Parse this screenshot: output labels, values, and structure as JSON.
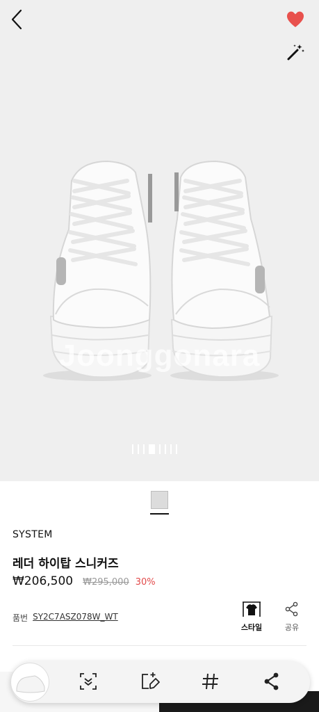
{
  "hero": {
    "watermark": "Joonggonara",
    "pager": {
      "count": 8,
      "active_index": 3
    }
  },
  "icons": {
    "back": "back-arrow-icon",
    "favorite": "heart-icon",
    "magic": "magic-wand-icon",
    "accent": "#e8514d"
  },
  "colors": {
    "swatch": "#dcdcdc",
    "discount": "#e24a4a"
  },
  "product": {
    "brand": "SYSTEM",
    "name": "레더 하이탑 스니커즈",
    "price": "₩206,500",
    "original_price": "₩295,000",
    "discount": "30%",
    "code_label": "품번",
    "code": "SY2C7ASZ078W_WT"
  },
  "actions": {
    "style_label": "스타일",
    "share_label": "공유"
  },
  "toolbar": {
    "items": [
      "thumbnail",
      "scan-icon",
      "edit-tag-icon",
      "hashtag-icon",
      "share-icon"
    ]
  }
}
